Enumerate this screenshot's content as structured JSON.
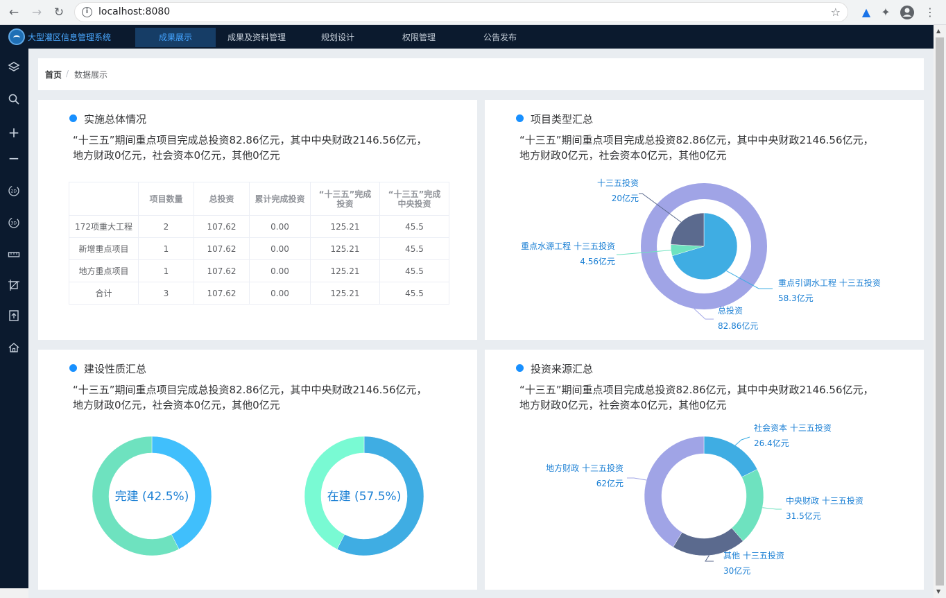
{
  "browser": {
    "url": "localhost:8080"
  },
  "nav": {
    "app_title": "大型灌区信息管理系统",
    "tabs": [
      {
        "label": "成果展示",
        "active": true
      },
      {
        "label": "成果及资料管理",
        "active": false
      },
      {
        "label": "规划设计",
        "active": false
      },
      {
        "label": "权限管理",
        "active": false
      },
      {
        "label": "公告发布",
        "active": false
      }
    ]
  },
  "sidebar": {
    "icons": [
      "layers-icon",
      "search-icon",
      "zoom-in-icon",
      "zoom-out-icon",
      "view-2d-icon",
      "view-3d-icon",
      "ruler-icon",
      "area-measure-icon",
      "export-icon",
      "home-icon"
    ]
  },
  "breadcrumb": {
    "home": "首页",
    "separator": "/",
    "current": "数据展示"
  },
  "summary_text": {
    "line1": "“十三五”期间重点项目完成总投资82.86亿元，其中中央财政2146.56亿元，",
    "line2": "地方财政0亿元，社会资本0亿元，其他0亿元"
  },
  "cards": {
    "overall": {
      "title": "实施总体情况",
      "table": {
        "headers": [
          "",
          "项目数量",
          "总投资",
          "累计完成投资",
          "“十三五”完成投资",
          "“十三五”完成中央投资"
        ],
        "header_lines": [
          [
            ""
          ],
          [
            "项目数量"
          ],
          [
            "总投资"
          ],
          [
            "累计完成投资"
          ],
          [
            "“十三五”完成",
            "投资"
          ],
          [
            "“十三五”完成",
            "中央投资"
          ]
        ],
        "rows": [
          [
            "172项重大工程",
            "2",
            "107.62",
            "0.00",
            "125.21",
            "45.5"
          ],
          [
            "新增重点项目",
            "1",
            "107.62",
            "0.00",
            "125.21",
            "45.5"
          ],
          [
            "地方重点项目",
            "1",
            "107.62",
            "0.00",
            "125.21",
            "45.5"
          ],
          [
            "合计",
            "3",
            "107.62",
            "0.00",
            "125.21",
            "45.5"
          ]
        ]
      }
    },
    "project_type": {
      "title": "项目类型汇总"
    },
    "construction": {
      "title": "建设性质汇总"
    },
    "funding": {
      "title": "投资来源汇总"
    }
  },
  "chart_data": [
    {
      "id": "project-type",
      "type": "pie",
      "series": [
        {
          "name": "inner",
          "labels": [
            "十三五投资",
            "重点水源工程 十三五投资",
            "重点引调水工程 十三五投资"
          ],
          "values": [
            20,
            4.56,
            58.3
          ],
          "value_labels": [
            "20亿元",
            "4.56亿元",
            "58.3亿元"
          ],
          "colors": [
            "#5b6a8e",
            "#6ee2bf",
            "#3fade3"
          ]
        },
        {
          "name": "outer",
          "labels": [
            "总投资"
          ],
          "values": [
            82.86
          ],
          "value_labels": [
            "82.86亿元"
          ],
          "colors": [
            "#a0a4e6"
          ]
        }
      ]
    },
    {
      "id": "construction-complete",
      "type": "pie",
      "center_label": "完建 (42.5%)",
      "values": [
        42.5,
        57.5
      ],
      "colors": [
        "#40bffc",
        "#6ee2bf"
      ]
    },
    {
      "id": "construction-ongoing",
      "type": "pie",
      "center_label": "在建 (57.5%)",
      "values": [
        57.5,
        42.5
      ],
      "colors": [
        "#3fade3",
        "#79fad3"
      ]
    },
    {
      "id": "funding-source",
      "type": "pie",
      "labels": [
        "社会资本 十三五投资",
        "中央财政 十三五投资",
        "其他 十三五投资",
        "地方财政 十三五投资"
      ],
      "values": [
        26.4,
        31.5,
        30,
        62
      ],
      "value_labels": [
        "26.4亿元",
        "31.5亿元",
        "30亿元",
        "62亿元"
      ],
      "colors": [
        "#3fade3",
        "#6ee2bf",
        "#5b6a8e",
        "#a0a4e6"
      ]
    }
  ]
}
